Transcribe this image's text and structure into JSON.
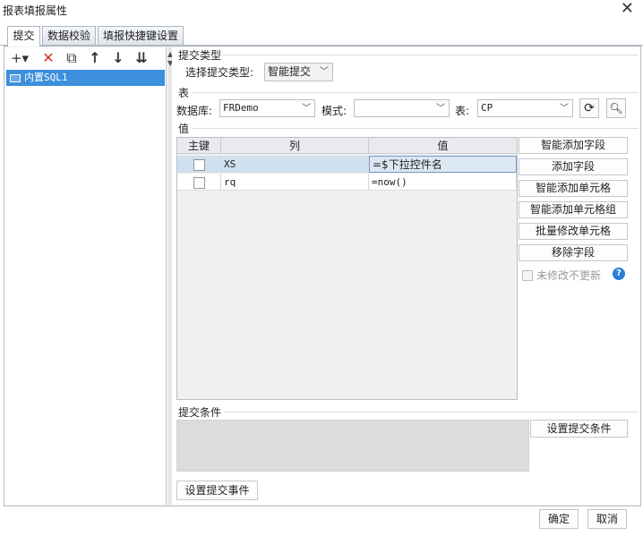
{
  "window": {
    "title": "报表填报属性",
    "close_icon": "close-icon"
  },
  "tabs": [
    {
      "label": "提交",
      "active": true
    },
    {
      "label": "数据校验",
      "active": false
    },
    {
      "label": "填报快捷键设置",
      "active": false
    }
  ],
  "toolbar": {
    "add_glyph": "+▾",
    "delete_glyph": "✕",
    "copy_glyph": "⧉",
    "up_glyph": "↑",
    "down_glyph": "↓",
    "sort_glyph": "⇊"
  },
  "tree": {
    "items": [
      {
        "label": "内置SQL1",
        "selected": true
      }
    ]
  },
  "submit_type": {
    "section_label": "提交类型",
    "select_label": "选择提交类型:",
    "select_value": "智能提交"
  },
  "table_section": {
    "section_label": "表",
    "db_label": "数据库:",
    "db_value": "FRDemo",
    "mode_label": "模式:",
    "mode_value": "",
    "table_label": "表:",
    "table_value": "CP"
  },
  "value_section": {
    "section_label": "值",
    "headers": {
      "key": "主键",
      "column": "列",
      "value": "值"
    },
    "rows": [
      {
        "key": false,
        "column": "XS",
        "value": "=$下拉控件名",
        "selected": true
      },
      {
        "key": false,
        "column": "rq",
        "value": "=now()",
        "selected": false
      }
    ],
    "buttons": {
      "smart_add_field": "智能添加字段",
      "add_field": "添加字段",
      "smart_add_cell": "智能添加单元格",
      "smart_add_cell_group": "智能添加单元格组",
      "batch_modify_cell": "批量修改单元格",
      "remove_field": "移除字段"
    },
    "no_update_label": "未修改不更新",
    "help_glyph": "?"
  },
  "condition": {
    "section_label": "提交条件",
    "set_button": "设置提交条件"
  },
  "event_button": "设置提交事件",
  "footer": {
    "ok": "确定",
    "cancel": "取消"
  }
}
